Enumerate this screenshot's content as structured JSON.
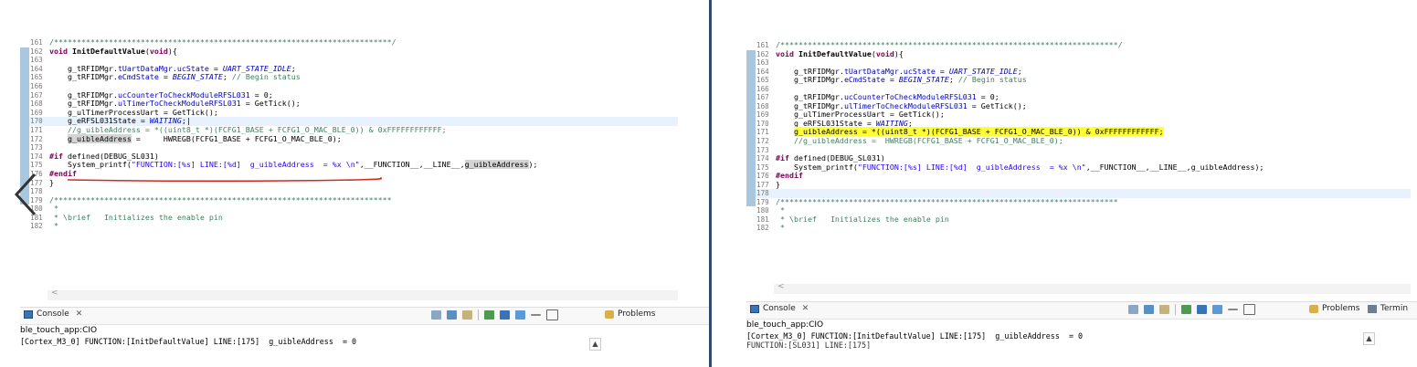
{
  "left": {
    "editor_lines": [
      {
        "num": "161",
        "gutter": false,
        "tokens": [
          {
            "c": "cmt",
            "t": "/**************************************************************************/"
          }
        ]
      },
      {
        "num": "162",
        "tokens": [
          {
            "c": "kw",
            "t": "void "
          },
          {
            "c": "fn",
            "t": "InitDefaultValue"
          },
          {
            "c": "",
            "t": "("
          },
          {
            "c": "kw",
            "t": "void"
          },
          {
            "c": "",
            "t": "){"
          }
        ]
      },
      {
        "num": "163",
        "tokens": []
      },
      {
        "num": "164",
        "tokens": [
          {
            "c": "",
            "t": "    g_tRFIDMgr."
          },
          {
            "c": "fld",
            "t": "tUartDataMgr"
          },
          {
            "c": "",
            "t": "."
          },
          {
            "c": "fld",
            "t": "ucState"
          },
          {
            "c": "",
            "t": " = "
          },
          {
            "c": "cst",
            "t": "UART_STATE_IDLE"
          },
          {
            "c": "",
            "t": ";"
          }
        ]
      },
      {
        "num": "165",
        "tokens": [
          {
            "c": "",
            "t": "    g_tRFIDMgr."
          },
          {
            "c": "fld",
            "t": "eCmdState"
          },
          {
            "c": "",
            "t": " = "
          },
          {
            "c": "cst",
            "t": "BEGIN_STATE"
          },
          {
            "c": "",
            "t": "; "
          },
          {
            "c": "cmt",
            "t": "// Begin status"
          }
        ]
      },
      {
        "num": "166",
        "tokens": []
      },
      {
        "num": "167",
        "tokens": [
          {
            "c": "",
            "t": "    g_tRFIDMgr."
          },
          {
            "c": "fld",
            "t": "ucCounterToCheckModuleRFSL031"
          },
          {
            "c": "",
            "t": " = 0;"
          }
        ]
      },
      {
        "num": "168",
        "tokens": [
          {
            "c": "",
            "t": "    g_tRFIDMgr."
          },
          {
            "c": "fld",
            "t": "ulTimerToCheckModuleRFSL031"
          },
          {
            "c": "",
            "t": " = GetTick();"
          }
        ]
      },
      {
        "num": "169",
        "tokens": [
          {
            "c": "",
            "t": "    g_ulTimerProcessUart = GetTick();"
          }
        ]
      },
      {
        "num": "170",
        "current": true,
        "tokens": [
          {
            "c": "",
            "t": "    g_eRFSL031State = "
          },
          {
            "c": "cst",
            "t": "WAITING"
          },
          {
            "c": "",
            "t": ";|"
          }
        ]
      },
      {
        "num": "171",
        "tokens": [
          {
            "c": "cmt",
            "t": "    //g_uibleAddress = *((uint8_t *)(FCFG1_BASE + FCFG1_O_MAC_BLE_0)) & 0xFFFFFFFFFFFF;"
          }
        ]
      },
      {
        "num": "172",
        "tokens": [
          {
            "c": "",
            "t": "    "
          },
          {
            "c": "occ",
            "t": "g_uibleAddress"
          },
          {
            "c": "",
            "t": " =     HWREGB(FCFG1_BASE + FCFG1_O_MAC_BLE_0);"
          }
        ]
      },
      {
        "num": "173",
        "tokens": []
      },
      {
        "num": "174",
        "tokens": [
          {
            "c": "dir",
            "t": "#if"
          },
          {
            "c": "",
            "t": " defined(DEBUG_SL031)"
          }
        ]
      },
      {
        "num": "175",
        "tokens": [
          {
            "c": "",
            "t": "    System_printf("
          },
          {
            "c": "str",
            "t": "\"FUNCTION:[%s] LINE:[%d]  g_uibleAddress  = %x \\n\""
          },
          {
            "c": "",
            "t": ",__FUNCTION__,__LINE__,"
          },
          {
            "c": "occ",
            "t": "g_uibleAddress"
          },
          {
            "c": "",
            "t": ");"
          }
        ]
      },
      {
        "num": "176",
        "tokens": [
          {
            "c": "dir",
            "t": "#endif"
          }
        ]
      },
      {
        "num": "177",
        "tokens": [
          {
            "c": "",
            "t": "}"
          }
        ]
      },
      {
        "num": "178",
        "tokens": []
      },
      {
        "num": "179",
        "tokens": [
          {
            "c": "cmt",
            "t": "/**************************************************************************"
          }
        ]
      },
      {
        "num": "180",
        "gutter": false,
        "tokens": [
          {
            "c": "cmt",
            "t": " *"
          }
        ]
      },
      {
        "num": "181",
        "gutter": false,
        "tokens": [
          {
            "c": "cmt",
            "t": " * \\brief   Initializes the enable pin"
          }
        ]
      },
      {
        "num": "182",
        "gutter": false,
        "tokens": [
          {
            "c": "cmt",
            "t": " *"
          }
        ]
      }
    ],
    "console_tab": "Console",
    "problems_tab": "Problems",
    "console_name": "ble_touch_app:CIO",
    "console_output": "[Cortex_M3_0] FUNCTION:[InitDefaultValue] LINE:[175]  g_uibleAddress  = 0"
  },
  "right": {
    "editor_lines": [
      {
        "num": "161",
        "gutter": false,
        "tokens": [
          {
            "c": "cmt",
            "t": "/**************************************************************************/"
          }
        ]
      },
      {
        "num": "162",
        "tokens": [
          {
            "c": "kw",
            "t": "void "
          },
          {
            "c": "fn",
            "t": "InitDefaultValue"
          },
          {
            "c": "",
            "t": "("
          },
          {
            "c": "kw",
            "t": "void"
          },
          {
            "c": "",
            "t": "){"
          }
        ]
      },
      {
        "num": "163",
        "tokens": []
      },
      {
        "num": "164",
        "tokens": [
          {
            "c": "",
            "t": "    g_tRFIDMgr."
          },
          {
            "c": "fld",
            "t": "tUartDataMgr"
          },
          {
            "c": "",
            "t": "."
          },
          {
            "c": "fld",
            "t": "ucState"
          },
          {
            "c": "",
            "t": " = "
          },
          {
            "c": "cst",
            "t": "UART_STATE_IDLE"
          },
          {
            "c": "",
            "t": ";"
          }
        ]
      },
      {
        "num": "165",
        "tokens": [
          {
            "c": "",
            "t": "    g_tRFIDMgr."
          },
          {
            "c": "fld",
            "t": "eCmdState"
          },
          {
            "c": "",
            "t": " = "
          },
          {
            "c": "cst",
            "t": "BEGIN_STATE"
          },
          {
            "c": "",
            "t": "; "
          },
          {
            "c": "cmt",
            "t": "// Begin status"
          }
        ]
      },
      {
        "num": "166",
        "tokens": []
      },
      {
        "num": "167",
        "tokens": [
          {
            "c": "",
            "t": "    g_tRFIDMgr."
          },
          {
            "c": "fld",
            "t": "ucCounterToCheckModuleRFSL031"
          },
          {
            "c": "",
            "t": " = 0;"
          }
        ]
      },
      {
        "num": "168",
        "tokens": [
          {
            "c": "",
            "t": "    g_tRFIDMgr."
          },
          {
            "c": "fld",
            "t": "ulTimerToCheckModuleRFSL031"
          },
          {
            "c": "",
            "t": " = GetTick();"
          }
        ]
      },
      {
        "num": "169",
        "tokens": [
          {
            "c": "",
            "t": "    g_ulTimerProcessUart = GetTick();"
          }
        ]
      },
      {
        "num": "170",
        "tokens": [
          {
            "c": "",
            "t": "    g_eRFSL031State = "
          },
          {
            "c": "cst",
            "t": "WAITING"
          },
          {
            "c": "",
            "t": ";"
          }
        ]
      },
      {
        "num": "171",
        "tokens": [
          {
            "c": "",
            "t": "    "
          },
          {
            "c": "hl",
            "t": "g_uibleAddress = *((uint8_t *)(FCFG1_BASE + FCFG1_O_MAC_BLE_0)) & 0xFFFFFFFFFFFF;"
          }
        ]
      },
      {
        "num": "172",
        "tokens": [
          {
            "c": "cmt",
            "t": "    //g_uibleAddress =  HWREGB(FCFG1_BASE + FCFG1_O_MAC_BLE_0);"
          }
        ]
      },
      {
        "num": "173",
        "tokens": []
      },
      {
        "num": "174",
        "tokens": [
          {
            "c": "dir",
            "t": "#if"
          },
          {
            "c": "",
            "t": " defined(DEBUG_SL031)"
          }
        ]
      },
      {
        "num": "175",
        "tokens": [
          {
            "c": "",
            "t": "    System_printf("
          },
          {
            "c": "str",
            "t": "\"FUNCTION:[%s] LINE:[%d]  g_uibleAddress  = %x \\n\""
          },
          {
            "c": "",
            "t": ",__FUNCTION__,__LINE__,g_uibleAddress);"
          }
        ]
      },
      {
        "num": "176",
        "tokens": [
          {
            "c": "dir",
            "t": "#endif"
          }
        ]
      },
      {
        "num": "177",
        "tokens": [
          {
            "c": "",
            "t": "}"
          }
        ]
      },
      {
        "num": "178",
        "current": true,
        "tokens": []
      },
      {
        "num": "179",
        "tokens": [
          {
            "c": "cmt",
            "t": "/**************************************************************************"
          }
        ]
      },
      {
        "num": "180",
        "gutter": false,
        "tokens": [
          {
            "c": "cmt",
            "t": " *"
          }
        ]
      },
      {
        "num": "181",
        "gutter": false,
        "tokens": [
          {
            "c": "cmt",
            "t": " * \\brief   Initializes the enable pin"
          }
        ]
      },
      {
        "num": "182",
        "gutter": false,
        "tokens": [
          {
            "c": "cmt",
            "t": " *"
          }
        ]
      }
    ],
    "console_tab": "Console",
    "problems_tab": "Problems",
    "terminal_tab": "Termin",
    "console_name": "ble_touch_app:CIO",
    "console_output": "[Cortex_M3_0] FUNCTION:[InitDefaultValue] LINE:[175]  g_uibleAddress  = 0",
    "console_output_partial": "FUNCTION:[SL031] LINE:[175]"
  },
  "colors": {
    "highlight": "#ffff33",
    "underline": "#d42a1e",
    "divider": "#2c4a6e",
    "gutter": "#a9c8df"
  },
  "icons": [
    "back-chevron-icon",
    "console-icon",
    "close-icon",
    "problems-icon",
    "terminal-icon",
    "scroll-up-icon",
    "scroll-left-icon"
  ]
}
